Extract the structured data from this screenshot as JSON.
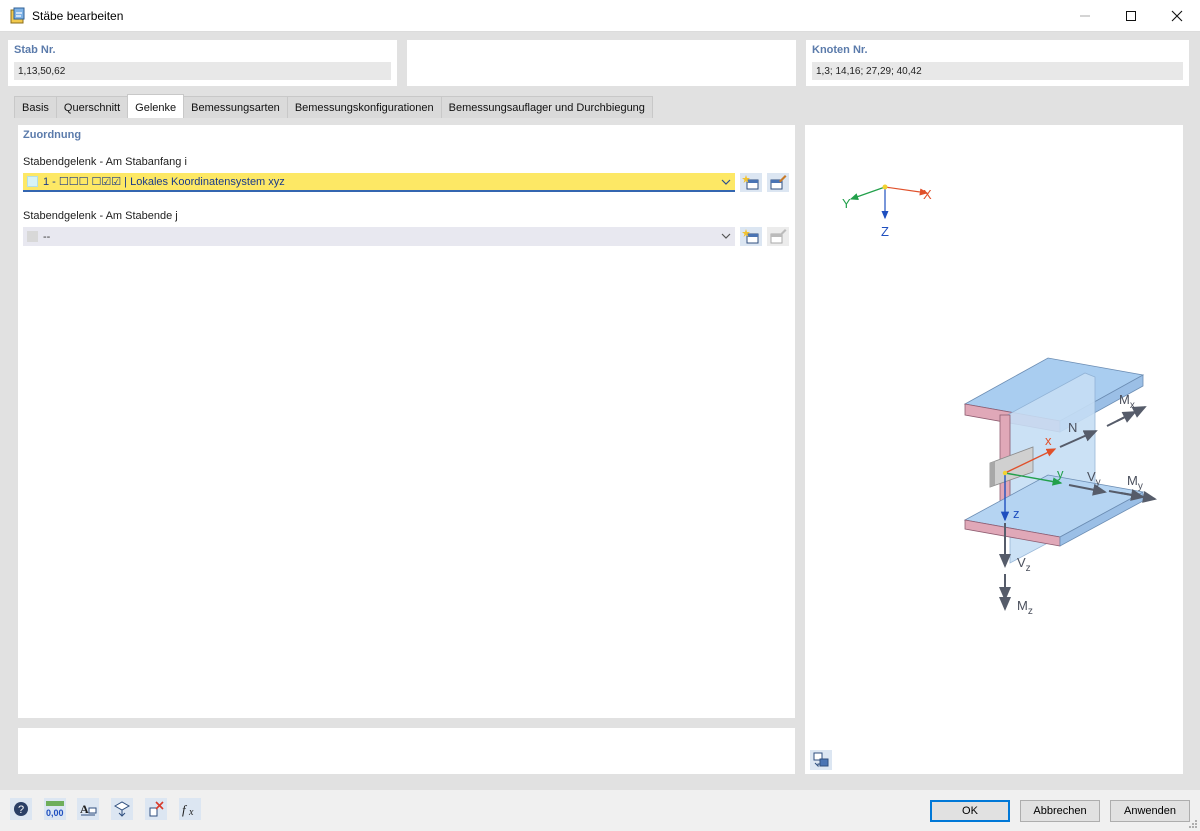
{
  "window": {
    "title": "Stäbe bearbeiten"
  },
  "header": {
    "member": {
      "label": "Stab Nr.",
      "value": "1,13,50,62"
    },
    "nodes": {
      "label": "Knoten Nr.",
      "value": "1,3; 14,16; 27,29; 40,42"
    }
  },
  "tabs": [
    {
      "label": "Basis",
      "active": false
    },
    {
      "label": "Querschnitt",
      "active": false
    },
    {
      "label": "Gelenke",
      "active": true
    },
    {
      "label": "Bemessungsarten",
      "active": false
    },
    {
      "label": "Bemessungskonfigurationen",
      "active": false
    },
    {
      "label": "Bemessungsauflager und Durchbiegung",
      "active": false
    }
  ],
  "assignment": {
    "title": "Zuordnung",
    "start_label": "Stabendgelenk - Am Stabanfang i",
    "start_value": "1 - ☐☐☐  ☐☑☑ | Lokales Koordinatensystem xyz",
    "end_label": "Stabendgelenk - Am Stabende j",
    "end_value": "--"
  },
  "diagram": {
    "global_axes": {
      "x": "X",
      "y": "Y",
      "z": "Z"
    },
    "local_axes": {
      "x": "x",
      "y": "y",
      "z": "z"
    },
    "forces": {
      "n": "N",
      "mx": "M",
      "mx_sub": "x",
      "vy": "V",
      "vy_sub": "y",
      "my": "M",
      "my_sub": "y",
      "vz": "V",
      "vz_sub": "z",
      "mz": "M",
      "mz_sub": "z"
    }
  },
  "buttons": {
    "ok": "OK",
    "cancel": "Abbrechen",
    "apply": "Anwenden"
  },
  "bottom_icons": {
    "numeric_label": "0,00"
  },
  "colors": {
    "accent": "#0078d7",
    "section_label": "#5b7bab",
    "selected_combo": "#fde865",
    "x_axis": "#e0502a",
    "y_axis": "#22a04b",
    "z_axis": "#1f4fbf"
  }
}
